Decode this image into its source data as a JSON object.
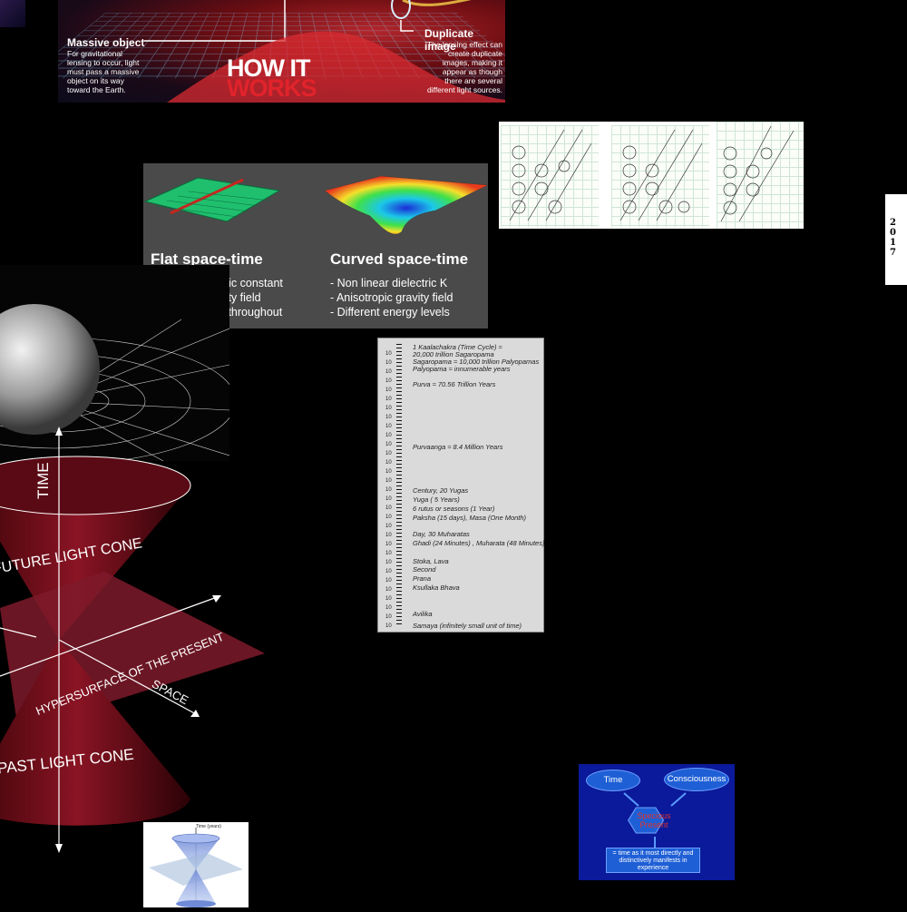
{
  "how_it_works": {
    "massive_title": "Massive object",
    "massive_text": [
      "For gravitational",
      "lensing to occur, light",
      "must pass a massive",
      "object on its way",
      "toward the Earth."
    ],
    "duplicate_title": "Duplicate image",
    "duplicate_text": [
      "The lensing effect can",
      "create duplicate",
      "images, making it",
      "appear as though",
      "there are several",
      "different light sources."
    ],
    "logo_line1": "HOW IT",
    "logo_line2": "WORKS"
  },
  "spacetime": {
    "flat_title": "Flat space-time",
    "flat_items": [
      "- Linear dielectric constant",
      "- Isotropic gravity field",
      "- Same energy throughout"
    ],
    "curved_title": "Curved space-time",
    "curved_items": [
      "- Non linear dielectric K",
      "- Anisotropic gravity field",
      "- Different energy levels"
    ]
  },
  "timeline": {
    "entries": [
      "1 Kaalachakra (Time Cycle) ≈",
      "20,000 trillion Sagaropama",
      "Sagaropama ≈ 10,000 trillion Palyopamas",
      "Palyopama ≈ innumerable years",
      "Purva ≈ 70.56 Trillion Years",
      "Purvaanga ≈ 8.4 Million Years",
      "Century, 20 Yugas",
      "Yuga ( 5 Years)",
      "6 rutus or seasons (1 Year)",
      "Paksha (15 days), Masa (One Month)",
      "Day, 30 Muharatas",
      "Ghadi (24 Minutes) , Muharata (48 Minutes)",
      "Stoka,  Lava",
      "Second",
      "Prana",
      "Ksullaka Bhava",
      "Avilika",
      "Samaya (infinitely small unit of time)"
    ],
    "axis": [
      "10",
      "10",
      "10",
      "10",
      "10",
      "10",
      "10",
      "10",
      "10",
      "10",
      "10",
      "10",
      "10",
      "10",
      "10",
      "10",
      "10",
      "10",
      "10",
      "10",
      "10",
      "10",
      "10",
      "10",
      "10",
      "10",
      "10",
      "10",
      "10",
      "10",
      "10"
    ]
  },
  "light_cone": {
    "time": "TIME",
    "future": "FUTURE LIGHT CONE",
    "hypersurface": "HYPERSURFACE OF THE PRESENT",
    "space": "SPACE",
    "past": "PAST LIGHT CONE"
  },
  "strip": {
    "year": [
      "2",
      "0",
      "1",
      "7"
    ]
  },
  "specious": {
    "time": "Time",
    "consciousness": "Consciousness",
    "center": "Specious Present",
    "box": "= time as it most directly and distinctively manifests in experience"
  },
  "small_cone": {
    "label": "Time (years)"
  },
  "colors": {
    "background": "#000000",
    "accent_red": "#e1232b",
    "specious_blue": "#0a1a9a"
  }
}
